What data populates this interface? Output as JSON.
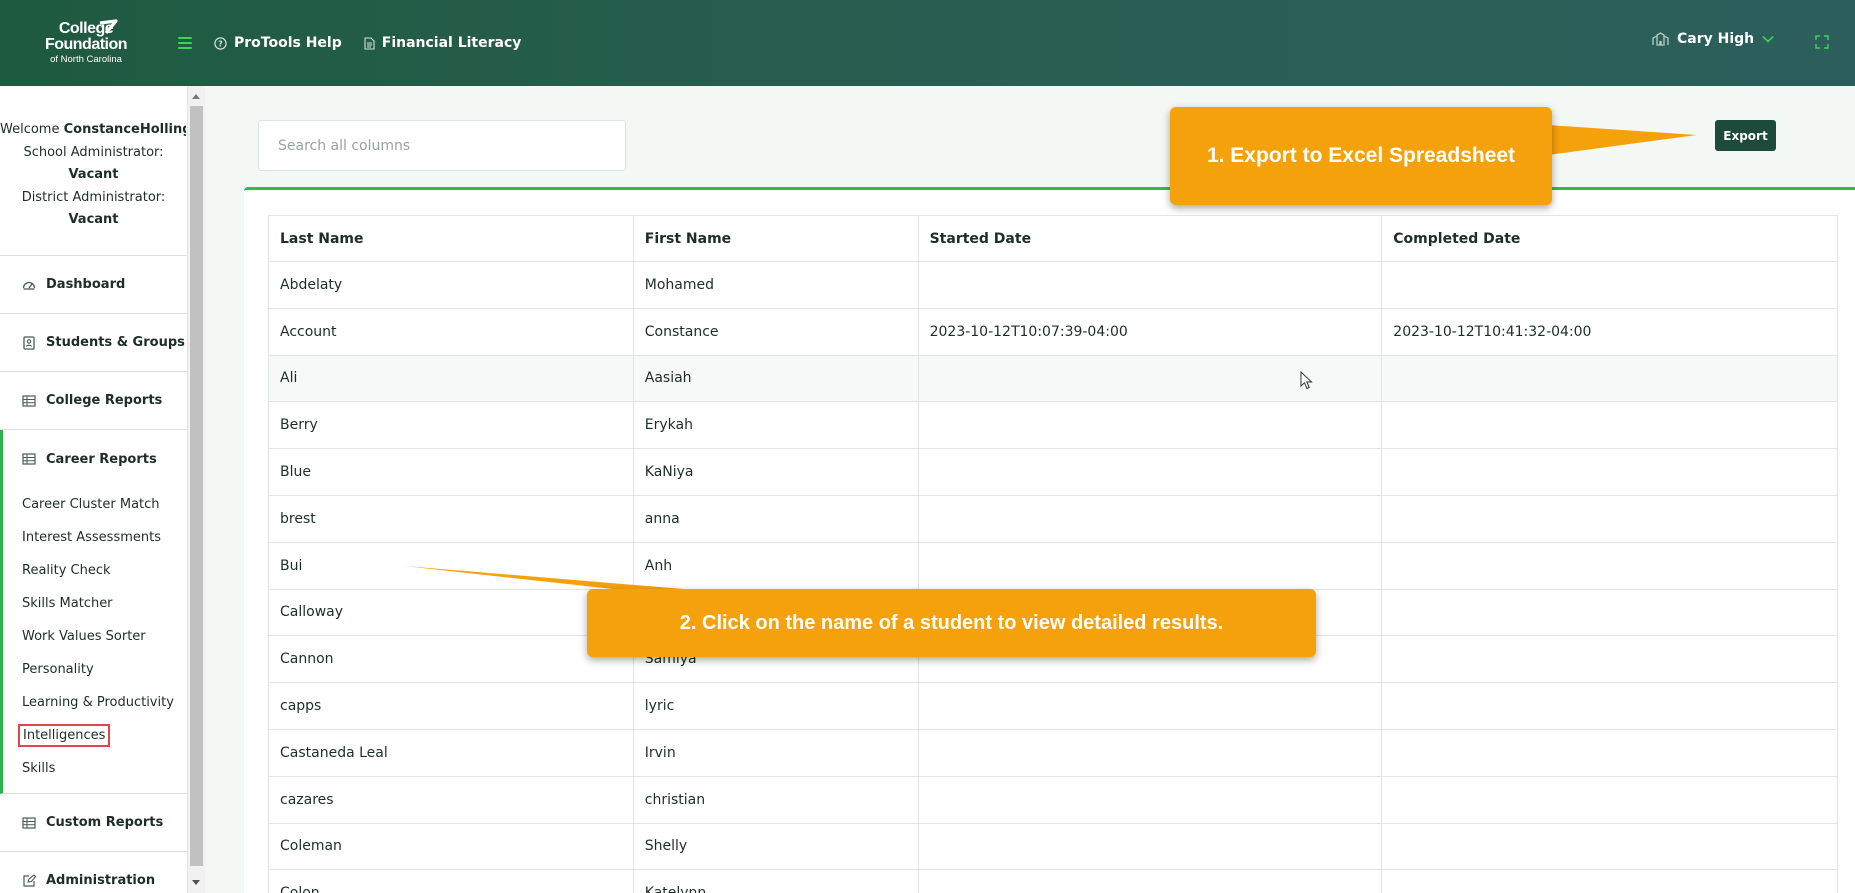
{
  "header": {
    "logo": {
      "line1": "College",
      "line2": "Foundation",
      "line3": "of North Carolina"
    },
    "nav": [
      {
        "label": "ProTools Help",
        "icon": "help-circle-icon"
      },
      {
        "label": "Financial Literacy",
        "icon": "document-icon"
      }
    ],
    "school": "Cary High"
  },
  "sidebar": {
    "welcome_prefix": "Welcome",
    "user_name": "ConstanceHollingsw",
    "school_admin_label": "School Administrator:",
    "school_admin_value": "Vacant",
    "district_admin_label": "District Administrator:",
    "district_admin_value": "Vacant",
    "sections": [
      {
        "label": "Dashboard",
        "icon": "dashboard-icon"
      },
      {
        "label": "Students & Groups",
        "icon": "student-icon"
      },
      {
        "label": "College Reports",
        "icon": "table-icon"
      }
    ],
    "career": {
      "label": "Career Reports",
      "items": [
        "Career Cluster Match",
        "Interest Assessments",
        "Reality Check",
        "Skills Matcher",
        "Work Values Sorter",
        "Personality",
        "Learning & Productivity",
        "Intelligences",
        "Skills"
      ],
      "active": "Intelligences"
    },
    "bottom_sections": [
      {
        "label": "Custom Reports",
        "icon": "table-icon"
      },
      {
        "label": "Administration",
        "icon": "edit-icon"
      }
    ]
  },
  "search": {
    "placeholder": "Search all columns",
    "value": ""
  },
  "toolbar": {
    "export_label": "Export"
  },
  "table": {
    "headers": [
      "Last Name",
      "First Name",
      "Started Date",
      "Completed Date"
    ],
    "rows": [
      [
        "Abdelaty",
        "Mohamed",
        "",
        ""
      ],
      [
        "Account",
        "Constance",
        "2023-10-12T10:07:39-04:00",
        "2023-10-12T10:41:32-04:00"
      ],
      [
        "Ali",
        "Aasiah",
        "",
        ""
      ],
      [
        "Berry",
        "Erykah",
        "",
        ""
      ],
      [
        "Blue",
        "KaNiya",
        "",
        ""
      ],
      [
        "brest",
        "anna",
        "",
        ""
      ],
      [
        "Bui",
        "Anh",
        "",
        ""
      ],
      [
        "Calloway",
        "",
        "",
        ""
      ],
      [
        "Cannon",
        "Samiya",
        "",
        ""
      ],
      [
        "capps",
        "lyric",
        "",
        ""
      ],
      [
        "Castaneda Leal",
        "Irvin",
        "",
        ""
      ],
      [
        "cazares",
        "christian",
        "",
        ""
      ],
      [
        "Coleman",
        "Shelly",
        "",
        ""
      ],
      [
        "Colon",
        "Katelynn",
        "",
        ""
      ]
    ]
  },
  "callouts": {
    "export": "1.  Export to Excel Spreadsheet",
    "click_name": "2. Click on the name of a student to view detailed results."
  },
  "colors": {
    "header": "#285e50",
    "accent_green": "#2bc045",
    "callout": "#f4a10c",
    "export_button": "#1d4a3b"
  }
}
